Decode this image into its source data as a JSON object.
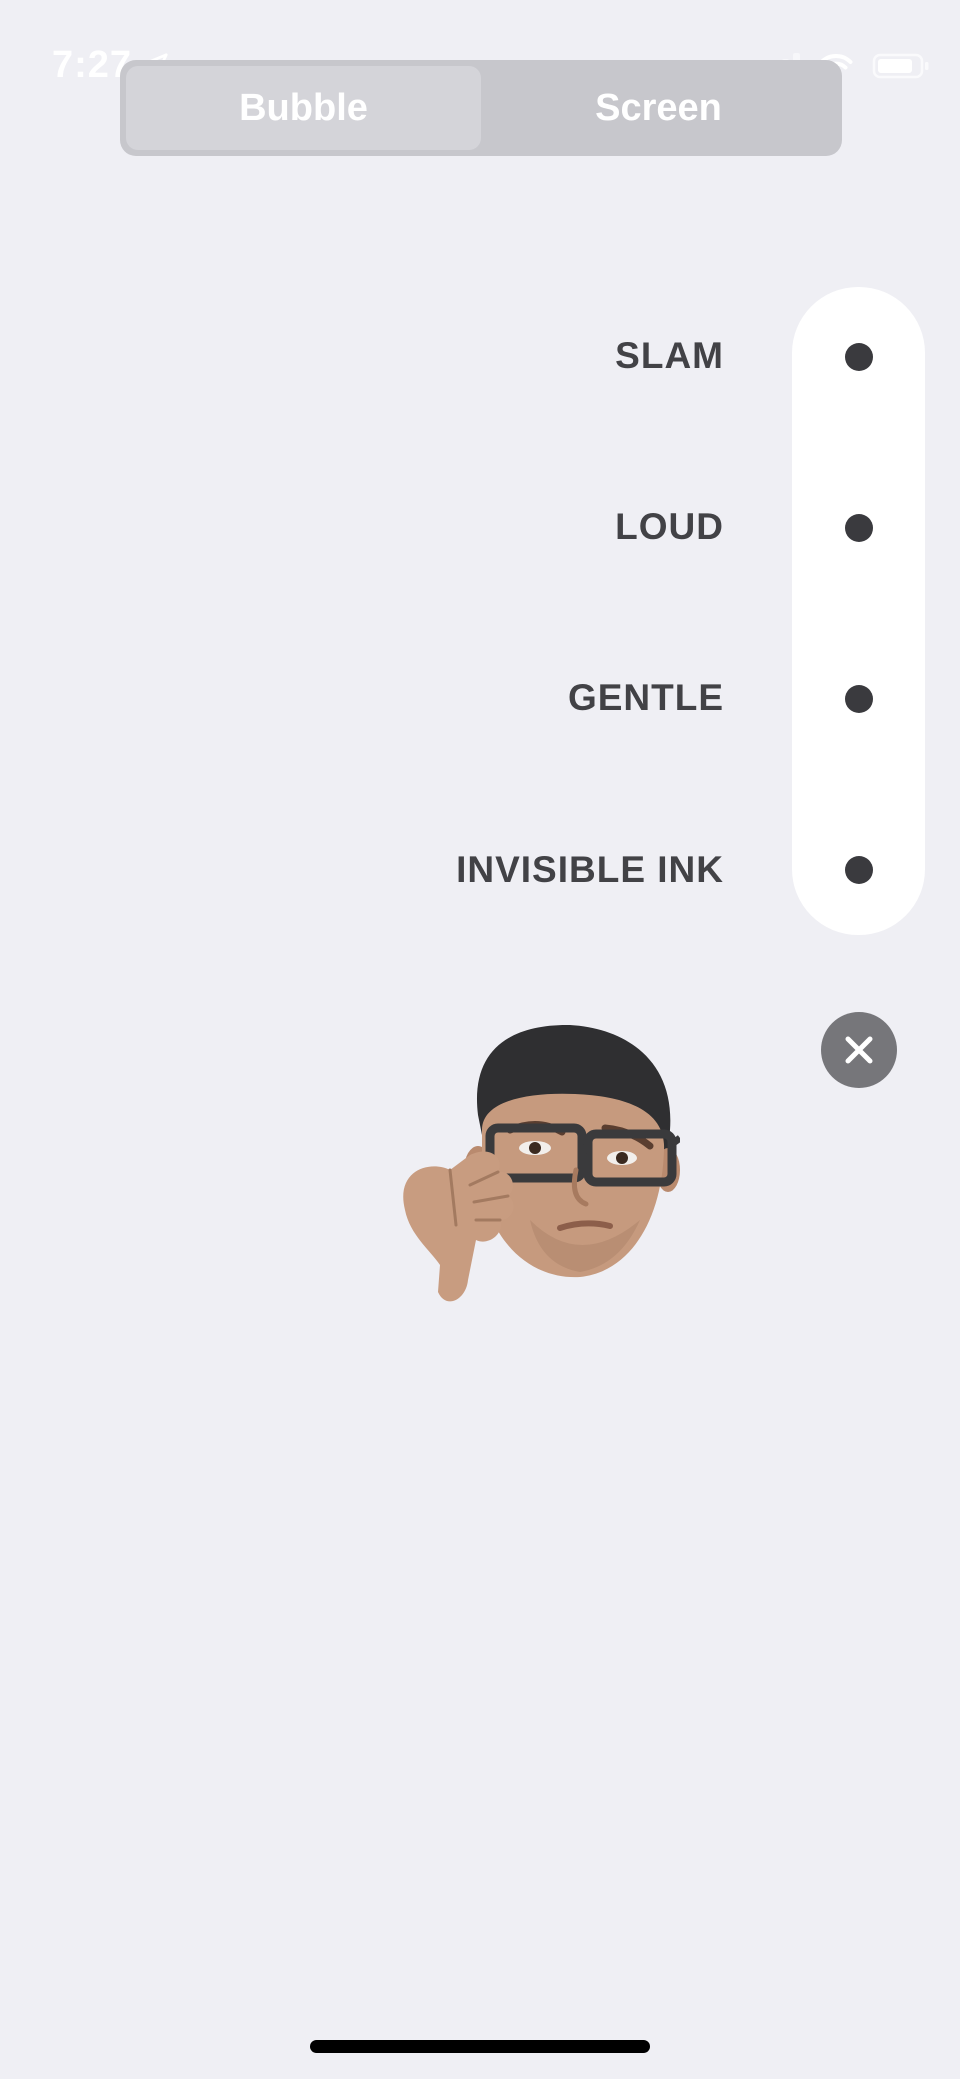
{
  "status_bar": {
    "time": "7:27",
    "location_icon": "location-arrow-icon",
    "signal_icon": "cellular-signal-icon",
    "wifi_icon": "wifi-icon",
    "battery_icon": "battery-icon"
  },
  "segmented_control": {
    "options": [
      "Bubble",
      "Screen"
    ],
    "selected": "Bubble"
  },
  "effects": [
    {
      "label": "SLAM"
    },
    {
      "label": "LOUD"
    },
    {
      "label": "GENTLE"
    },
    {
      "label": "INVISIBLE INK"
    }
  ],
  "close_icon": "close-x-icon",
  "memoji_icon": "memoji-thumbs-down-icon",
  "colors": {
    "background": "#efeff4",
    "segment_track": "#c7c7cc",
    "segment_selected": "#d4d4d9",
    "label_text": "#424246",
    "dot": "#3a3a3e",
    "close_button": "#76767a"
  }
}
